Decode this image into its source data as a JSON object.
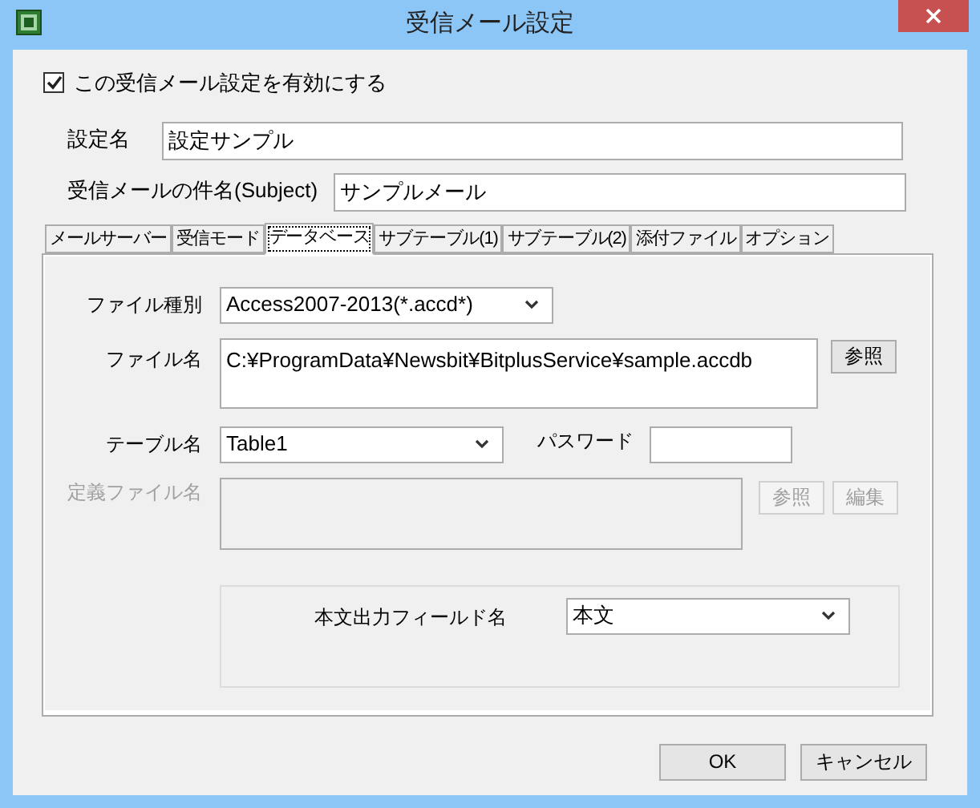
{
  "window": {
    "title": "受信メール設定"
  },
  "enable_checkbox": {
    "label": "この受信メール設定を有効にする",
    "checked": true
  },
  "fields": [
    {
      "label": "設定名",
      "value": "設定サンプル"
    },
    {
      "label": "受信メールの件名(Subject)",
      "value": "サンプルメール"
    }
  ],
  "tabs": [
    {
      "label": "メールサーバー",
      "selected": false
    },
    {
      "label": "受信モード",
      "selected": false
    },
    {
      "label": "データベース",
      "selected": true
    },
    {
      "label": "サブテーブル(1)",
      "selected": false
    },
    {
      "label": "サブテーブル(2)",
      "selected": false
    },
    {
      "label": "添付ファイル",
      "selected": false
    },
    {
      "label": "オプション",
      "selected": false
    }
  ],
  "database": {
    "file_type": {
      "label": "ファイル種別",
      "value": "Access2007-2013(*.accd*)"
    },
    "file_name": {
      "label": "ファイル名",
      "value": "C:¥ProgramData¥Newsbit¥BitplusService¥sample.accdb",
      "button": {
        "label": "参照",
        "disabled": false
      }
    },
    "table_name": {
      "label": "テーブル名",
      "value": "Table1"
    },
    "password": {
      "label": "パスワード"
    },
    "definition_file": {
      "label": "定義ファイル名",
      "disabled": true,
      "buttons": [
        {
          "label": "参照",
          "disabled": true
        },
        {
          "label": "編集",
          "disabled": true
        }
      ]
    },
    "body_field": {
      "label": "本文出力フィールド名",
      "value": "本文"
    }
  },
  "buttons": [
    "OK",
    "キャンセル"
  ]
}
